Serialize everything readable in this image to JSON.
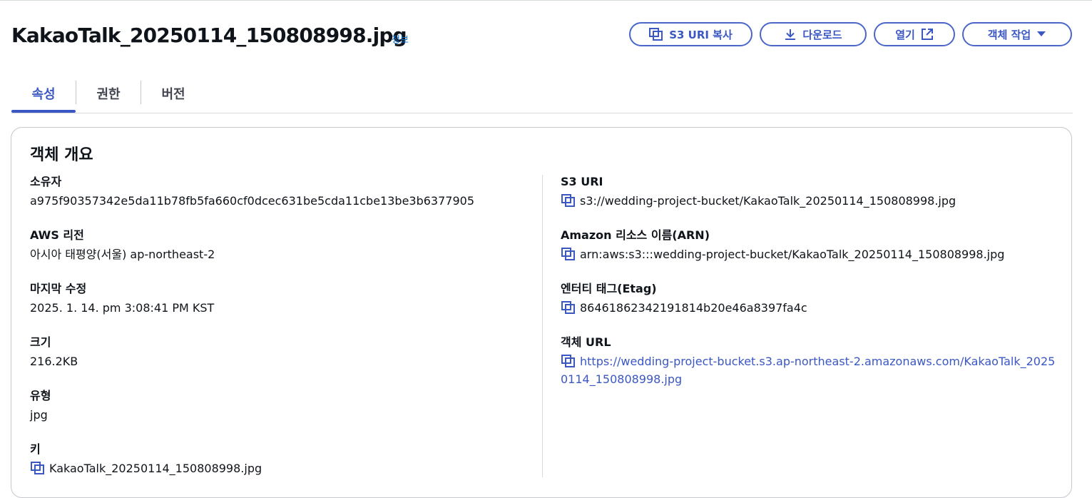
{
  "header": {
    "title": "KakaoTalk_20250114_150808998.jpg",
    "info": "정보",
    "buttons": {
      "copy_uri": "S3 URI 복사",
      "download": "다운로드",
      "open": "열기",
      "actions": "객체 작업"
    }
  },
  "tabs": [
    {
      "label": "속성",
      "active": true
    },
    {
      "label": "권한",
      "active": false
    },
    {
      "label": "버전",
      "active": false
    }
  ],
  "overview": {
    "title": "객체 개요",
    "left": {
      "owner": {
        "label": "소유자",
        "value": "a975f90357342e5da11b78fb5fa660cf0dcec631be5cda11cbe13be3b6377905"
      },
      "region": {
        "label": "AWS 리전",
        "value": "아시아 태평양(서울) ap-northeast-2"
      },
      "modified": {
        "label": "마지막 수정",
        "value": "2025. 1. 14. pm 3:08:41 PM KST"
      },
      "size": {
        "label": "크기",
        "value": "216.2KB"
      },
      "type": {
        "label": "유형",
        "value": "jpg"
      },
      "key": {
        "label": "키",
        "value": "KakaoTalk_20250114_150808998.jpg"
      }
    },
    "right": {
      "s3_uri": {
        "label": "S3 URI",
        "value": "s3://wedding-project-bucket/KakaoTalk_20250114_150808998.jpg"
      },
      "arn": {
        "label": "Amazon 리소스 이름(ARN)",
        "value": "arn:aws:s3:::wedding-project-bucket/KakaoTalk_20250114_150808998.jpg"
      },
      "etag": {
        "label": "엔터티 태그(Etag)",
        "value": "86461862342191814b20e46a8397fa4c"
      },
      "url": {
        "label": "객체 URL",
        "value": "https://wedding-project-bucket.s3.ap-northeast-2.amazonaws.com/KakaoTalk_20250114_150808998.jpg"
      }
    }
  },
  "colors": {
    "accent": "#3b57c4",
    "border": "#c6c6cd",
    "text": "#0f141a"
  },
  "icons": [
    "copy-icon",
    "download-icon",
    "external-link-icon",
    "caret-down-icon"
  ]
}
